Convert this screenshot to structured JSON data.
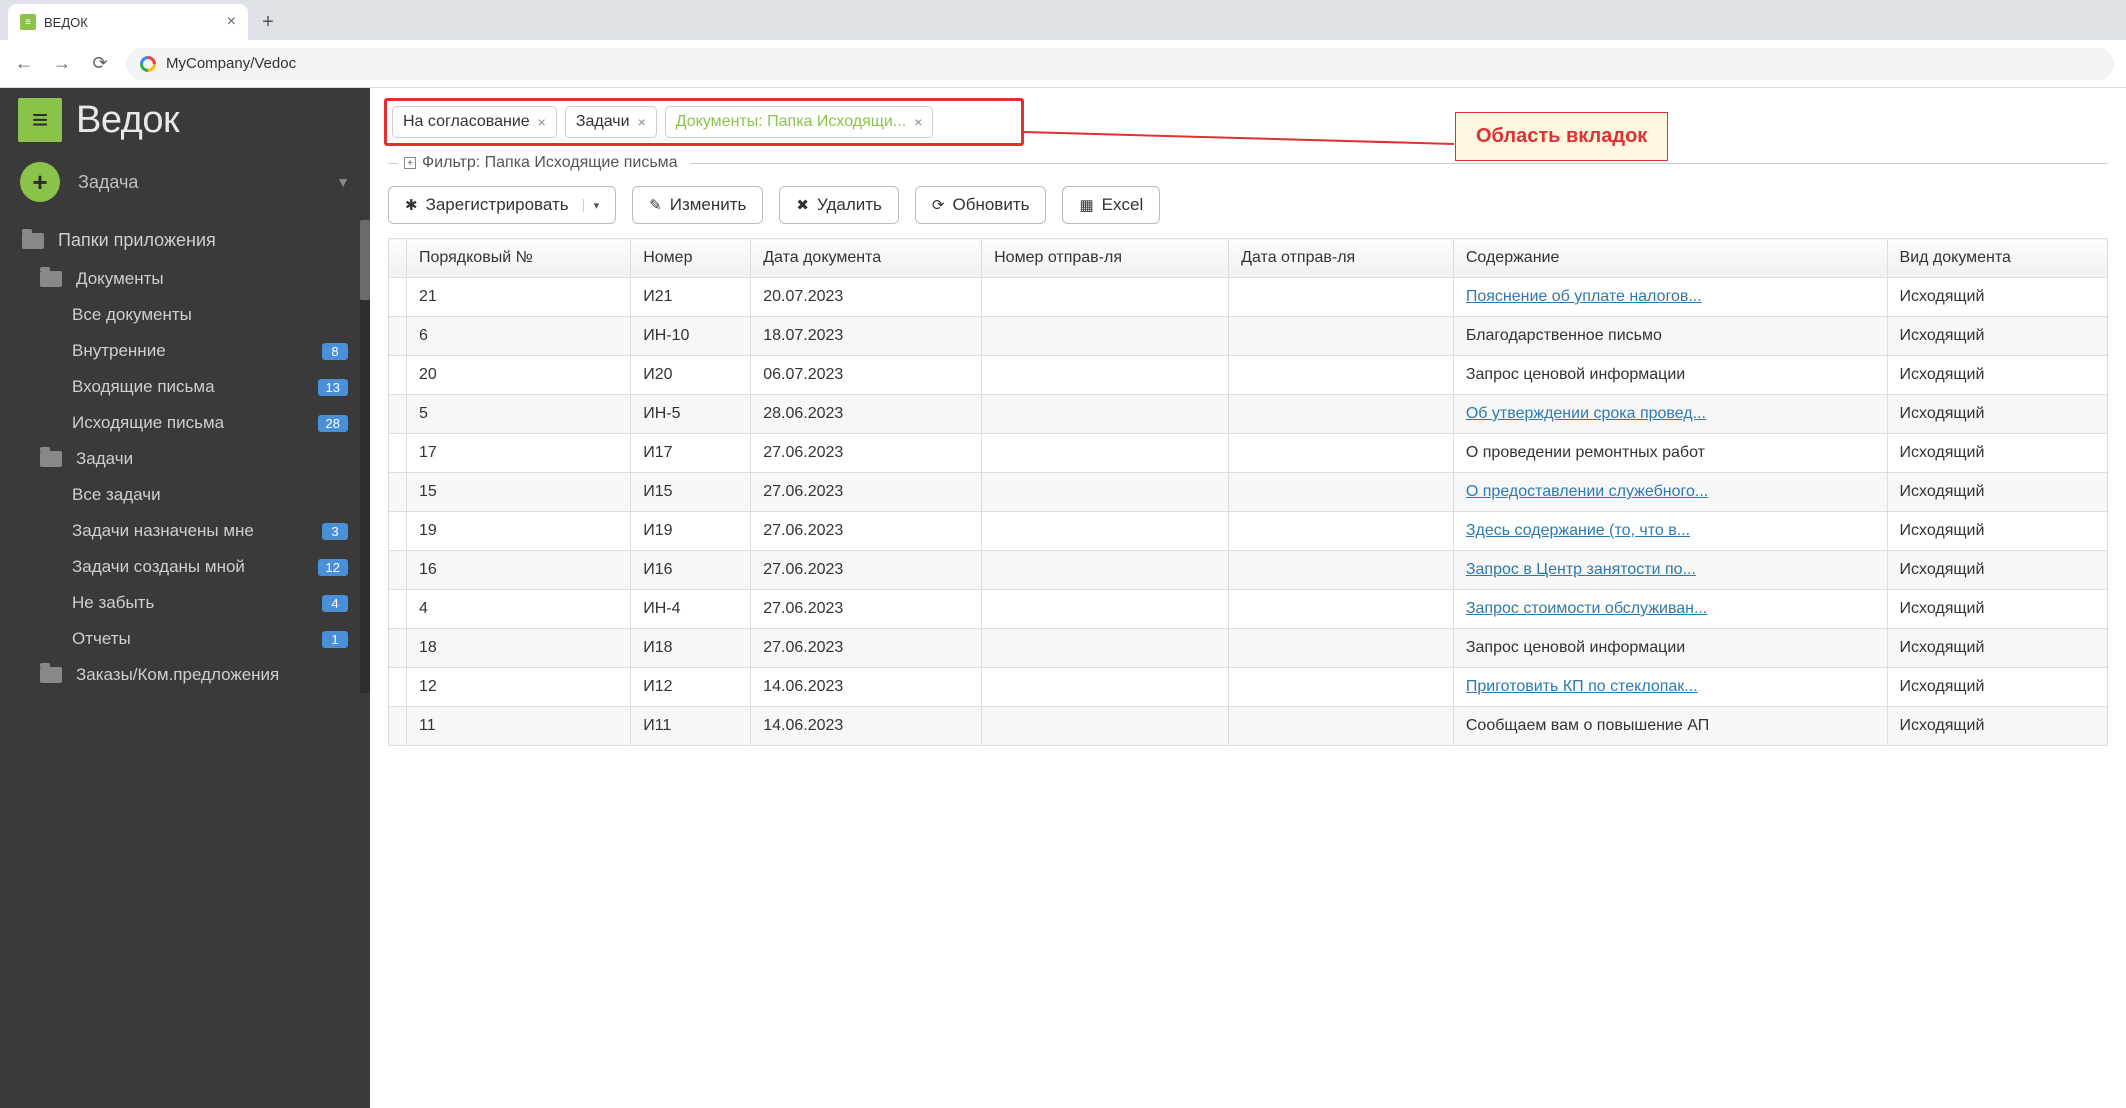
{
  "browser": {
    "tab_title": "ВЕДОК",
    "url": "MyCompany/Vedoc"
  },
  "sidebar": {
    "logo_text": "Ведок",
    "task_button": "Задача",
    "app_folders_label": "Папки приложения",
    "groups": [
      {
        "label": "Документы",
        "items": [
          {
            "label": "Все документы",
            "badge": ""
          },
          {
            "label": "Внутренние",
            "badge": "8"
          },
          {
            "label": "Входящие письма",
            "badge": "13"
          },
          {
            "label": "Исходящие письма",
            "badge": "28"
          }
        ]
      },
      {
        "label": "Задачи",
        "items": [
          {
            "label": "Все задачи",
            "badge": ""
          },
          {
            "label": "Задачи назначены мне",
            "badge": "3"
          },
          {
            "label": "Задачи созданы мной",
            "badge": "12"
          },
          {
            "label": "Не забыть",
            "badge": "4"
          },
          {
            "label": "Отчеты",
            "badge": "1"
          }
        ]
      },
      {
        "label": "Заказы/Ком.предложения",
        "items": []
      }
    ]
  },
  "tabs": [
    {
      "label": "На согласование",
      "active": false
    },
    {
      "label": "Задачи",
      "active": false
    },
    {
      "label": "Документы: Папка Исходящи...",
      "active": true
    }
  ],
  "callout": "Область вкладок",
  "filter_label": "Фильтр: Папка Исходящие письма",
  "actions": {
    "register": "Зарегистрировать",
    "edit": "Изменить",
    "delete": "Удалить",
    "refresh": "Обновить",
    "excel": "Excel"
  },
  "grid": {
    "columns": [
      "Порядковый №",
      "Номер",
      "Дата документа",
      "Номер отправ-ля",
      "Дата отправ-ля",
      "Содержание",
      "Вид документа"
    ],
    "rows": [
      {
        "seq": "21",
        "num": "И21",
        "date": "20.07.2023",
        "snum": "",
        "sdate": "",
        "content": "Пояснение об уплате налогов...",
        "is_link": true,
        "kind": "Исходящий"
      },
      {
        "seq": "6",
        "num": "ИН-10",
        "date": "18.07.2023",
        "snum": "",
        "sdate": "",
        "content": "Благодарственное письмо",
        "is_link": false,
        "kind": "Исходящий"
      },
      {
        "seq": "20",
        "num": "И20",
        "date": "06.07.2023",
        "snum": "",
        "sdate": "",
        "content": "Запрос ценовой информации",
        "is_link": false,
        "kind": "Исходящий"
      },
      {
        "seq": "5",
        "num": "ИН-5",
        "date": "28.06.2023",
        "snum": "",
        "sdate": "",
        "content": "Об утверждении срока провед...",
        "is_link": true,
        "kind": "Исходящий"
      },
      {
        "seq": "17",
        "num": "И17",
        "date": "27.06.2023",
        "snum": "",
        "sdate": "",
        "content": "О проведении ремонтных работ",
        "is_link": false,
        "kind": "Исходящий"
      },
      {
        "seq": "15",
        "num": "И15",
        "date": "27.06.2023",
        "snum": "",
        "sdate": "",
        "content": "О предоставлении служебного...",
        "is_link": true,
        "kind": "Исходящий"
      },
      {
        "seq": "19",
        "num": "И19",
        "date": "27.06.2023",
        "snum": "",
        "sdate": "",
        "content": "Здесь содержание (то, что в...",
        "is_link": true,
        "kind": "Исходящий"
      },
      {
        "seq": "16",
        "num": "И16",
        "date": "27.06.2023",
        "snum": "",
        "sdate": "",
        "content": "Запрос в Центр занятости по...",
        "is_link": true,
        "kind": "Исходящий"
      },
      {
        "seq": "4",
        "num": "ИН-4",
        "date": "27.06.2023",
        "snum": "",
        "sdate": "",
        "content": "Запрос стоимости обслуживан...",
        "is_link": true,
        "kind": "Исходящий"
      },
      {
        "seq": "18",
        "num": "И18",
        "date": "27.06.2023",
        "snum": "",
        "sdate": "",
        "content": "Запрос ценовой информации",
        "is_link": false,
        "kind": "Исходящий"
      },
      {
        "seq": "12",
        "num": "И12",
        "date": "14.06.2023",
        "snum": "",
        "sdate": "",
        "content": "Приготовить КП по стеклопак...",
        "is_link": true,
        "kind": "Исходящий"
      },
      {
        "seq": "11",
        "num": "И11",
        "date": "14.06.2023",
        "snum": "",
        "sdate": "",
        "content": "Сообщаем вам о повышение АП",
        "is_link": false,
        "kind": "Исходящий"
      }
    ]
  }
}
